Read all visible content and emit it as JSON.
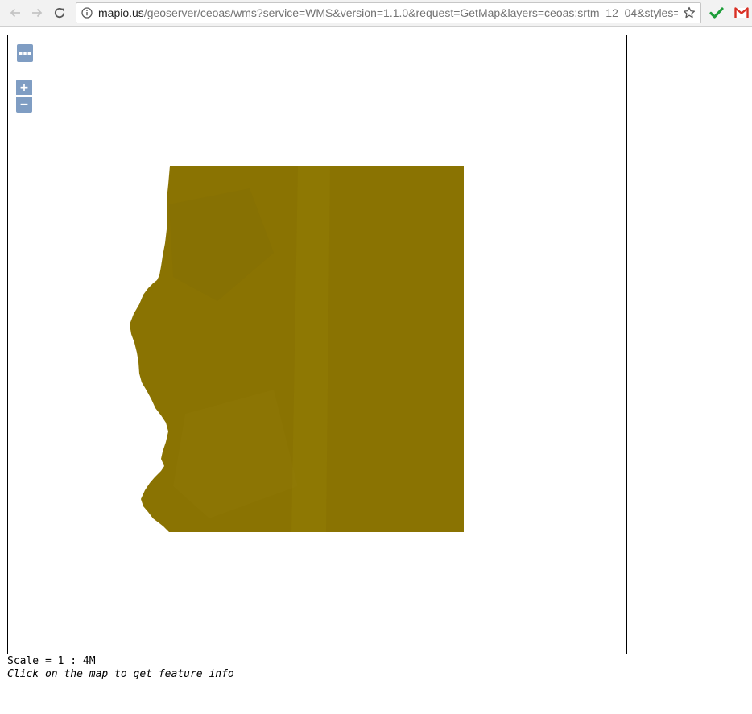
{
  "browser": {
    "url_host": "mapio.us",
    "url_path": "/geoserver/ceoas/wms?service=WMS&version=1.1.0&request=GetMap&layers=ceoas:srtm_12_04&styles=&",
    "back_icon": "arrow-left-icon",
    "forward_icon": "arrow-right-icon",
    "reload_icon": "reload-icon",
    "info_icon": "info-icon",
    "bookmark_icon": "star-icon",
    "extensions": [
      {
        "icon": "checkmark-icon",
        "color": "#1e9e3a"
      },
      {
        "icon": "gmail-icon",
        "color": "#d93025"
      }
    ]
  },
  "map": {
    "toggle_icon": "layer-switcher-icon",
    "zoom_in_label": "+",
    "zoom_out_label": "−",
    "raster_color": "#8a7302",
    "background_color": "#ffffff"
  },
  "footer": {
    "scale_text": "Scale = 1 : 4M",
    "hint_text": "Click on the map to get feature info"
  }
}
